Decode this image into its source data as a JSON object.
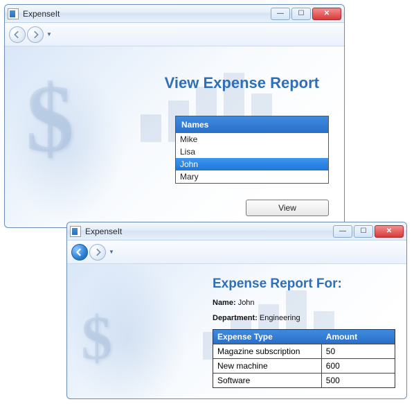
{
  "app": {
    "title": "ExpenseIt"
  },
  "winbuttons": {
    "min": "—",
    "max": "☐",
    "close": "✕"
  },
  "window1": {
    "heading": "View Expense Report",
    "names_header": "Names",
    "names": [
      "Mike",
      "Lisa",
      "John",
      "Mary"
    ],
    "selected": "John",
    "view_button": "View"
  },
  "window2": {
    "heading": "Expense Report For:",
    "name_label": "Name:",
    "name_value": "John",
    "dept_label": "Department:",
    "dept_value": "Engineering",
    "headers": {
      "type": "Expense Type",
      "amount": "Amount"
    },
    "rows": [
      {
        "type": "Magazine subscription",
        "amount": "50"
      },
      {
        "type": "New machine",
        "amount": "600"
      },
      {
        "type": "Software",
        "amount": "500"
      }
    ]
  }
}
